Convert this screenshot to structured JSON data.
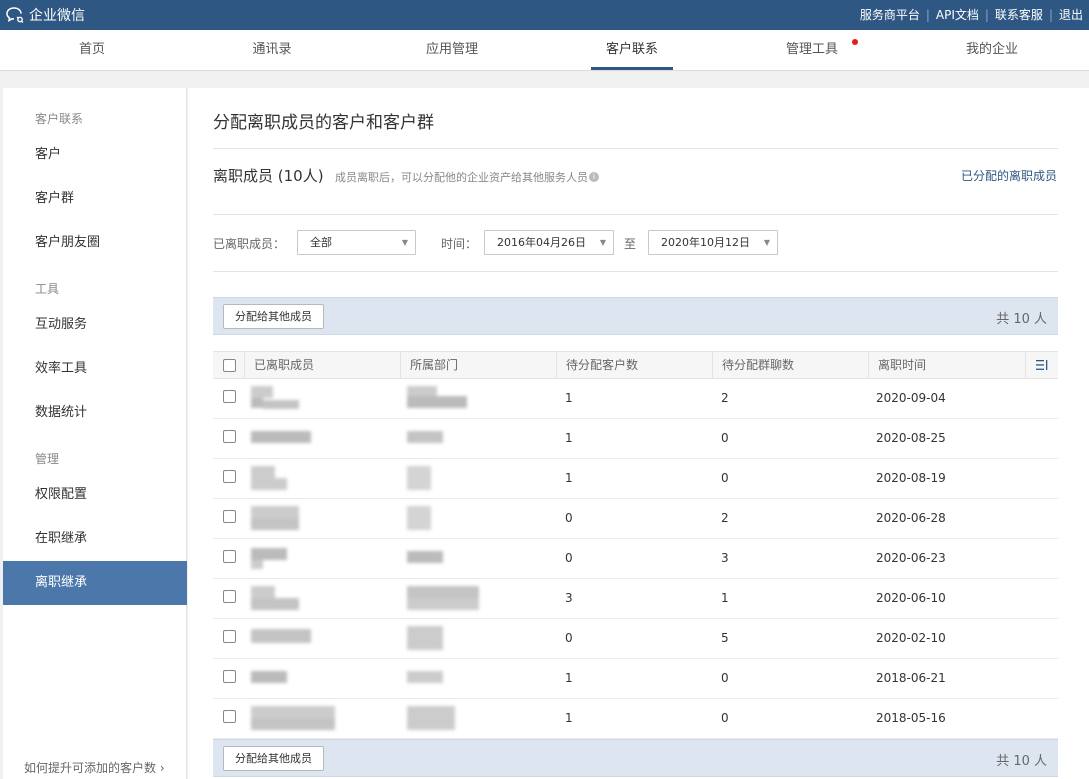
{
  "app": {
    "title": "企业微信",
    "logo_icon": "chat-bubbles-icon"
  },
  "top_links": [
    {
      "label": "服务商平台"
    },
    {
      "label": "API文档"
    },
    {
      "label": "联系客服"
    },
    {
      "label": "退出"
    }
  ],
  "nav": {
    "tabs": [
      {
        "label": "首页"
      },
      {
        "label": "通讯录"
      },
      {
        "label": "应用管理"
      },
      {
        "label": "客户联系",
        "active": true
      },
      {
        "label": "管理工具",
        "badge": "red-dot"
      },
      {
        "label": "我的企业"
      }
    ]
  },
  "sidebar": {
    "groups": [
      {
        "label": "客户联系"
      },
      {
        "label": "工具"
      },
      {
        "label": "管理"
      }
    ],
    "items": [
      {
        "label": "客户"
      },
      {
        "label": "客户群"
      },
      {
        "label": "客户朋友圈"
      },
      {
        "label": "互动服务"
      },
      {
        "label": "效率工具"
      },
      {
        "label": "数据统计"
      },
      {
        "label": "权限配置"
      },
      {
        "label": "在职继承"
      },
      {
        "label": "离职继承",
        "active": true
      }
    ],
    "bottom_link": "如何提升可添加的客户数"
  },
  "main": {
    "title": "分配离职成员的客户和客户群",
    "sub_title": "离职成员 (10人)",
    "sub_desc": "成员离职后，可以分配他的企业资产给其他服务人员",
    "assigned_link": "已分配的离职成员",
    "filters": {
      "member_label": "已离职成员：",
      "member_value": "全部",
      "time_label": "时间：",
      "start_date": "2016年04月26日",
      "range_sep": "至",
      "end_date": "2020年10月12日"
    },
    "action_button": "分配给其他成员",
    "total": "共 10 人",
    "columns": [
      "已离职成员",
      "所属部门",
      "待分配客户数",
      "待分配群聊数",
      "离职时间"
    ],
    "rows": [
      {
        "customers": "1",
        "groups": "2",
        "date": "2020-09-04"
      },
      {
        "customers": "1",
        "groups": "0",
        "date": "2020-08-25"
      },
      {
        "customers": "1",
        "groups": "0",
        "date": "2020-08-19"
      },
      {
        "customers": "0",
        "groups": "2",
        "date": "2020-06-28"
      },
      {
        "customers": "0",
        "groups": "3",
        "date": "2020-06-23"
      },
      {
        "customers": "3",
        "groups": "1",
        "date": "2020-06-10"
      },
      {
        "customers": "0",
        "groups": "5",
        "date": "2020-02-10"
      },
      {
        "customers": "1",
        "groups": "0",
        "date": "2018-06-21"
      },
      {
        "customers": "1",
        "groups": "0",
        "date": "2018-05-16"
      }
    ]
  },
  "colors": {
    "topbar": "#2f5783",
    "active_sidebar": "#4b77ab",
    "action_bar": "#dde6f0",
    "badge": "#e21b1b"
  }
}
